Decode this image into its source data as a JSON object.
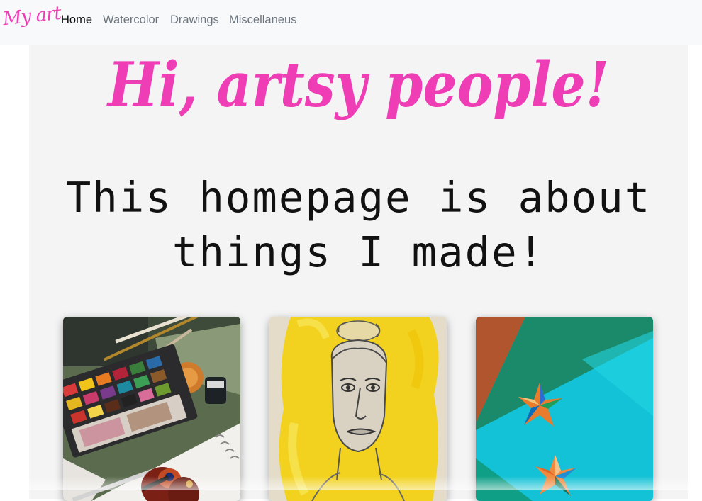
{
  "navbar": {
    "brand": "My art",
    "links": [
      {
        "label": "Home",
        "active": true
      },
      {
        "label": "Watercolor",
        "active": false
      },
      {
        "label": "Drawings",
        "active": false
      },
      {
        "label": "Miscellaneus",
        "active": false
      }
    ]
  },
  "main": {
    "heading": "Hi, artsy people!",
    "subheading": "This homepage is about things I made!"
  },
  "gallery": {
    "items": [
      {
        "name": "watercolor-photo"
      },
      {
        "name": "drawing-photo"
      },
      {
        "name": "miscellaneous-photo"
      }
    ]
  },
  "colors": {
    "accent": "#ee3db5",
    "nav_bg": "#f8f9fa",
    "content_bg": "#f4f4f5"
  }
}
